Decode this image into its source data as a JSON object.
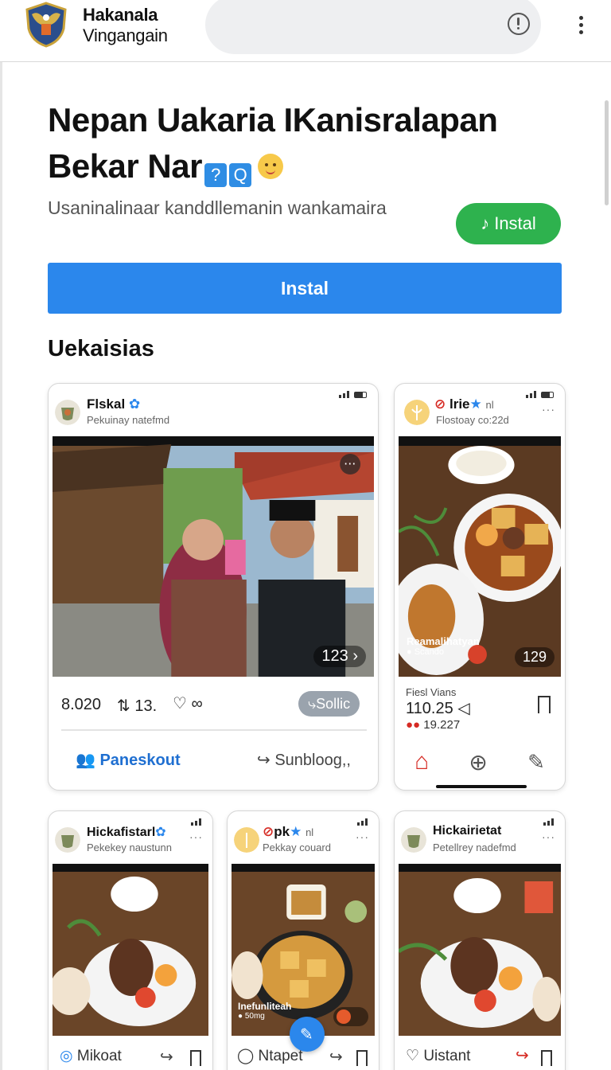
{
  "header": {
    "app_name_line1": "Hakanala",
    "app_name_line2": "Vingangain",
    "search_placeholder": ""
  },
  "hero": {
    "headline_line1": "Nepan Uakaria IKanisralapan",
    "headline_line2": "Bekar Nar",
    "headline_icons": [
      "?",
      "Q"
    ],
    "subtitle": "Usaninalinaar kanddllemanin wankamaira",
    "install_pill_label": "Instal",
    "install_bar_label": "Instal"
  },
  "section": {
    "title": "Uekaisias"
  },
  "cards": {
    "card1": {
      "name": "Flskal",
      "subtitle": "Pekuinay natefmd",
      "photo_badge": "123",
      "likes": "8.020",
      "reposts": "13.",
      "share_label": "Sollic",
      "action_primary": "Paneskout",
      "action_secondary": "Sunbloog,,"
    },
    "card2": {
      "name": "lrie",
      "name_suffix": "nl",
      "subtitle": "Flostoay co:22d",
      "photo_caption": "Reamalihatyan",
      "photo_subcaption": "Scando",
      "photo_badge": "129",
      "meta_label": "Fiesl Vians",
      "value": "110.25",
      "reactions": "19.227"
    },
    "card3": {
      "name": "Hickafistarl",
      "subtitle": "Pekekey naustunn",
      "action": "Mikoat"
    },
    "card4": {
      "name": "pk",
      "name_suffix": "nl",
      "subtitle": "Pekkay couard",
      "photo_caption": "Inefunliteah",
      "photo_subcaption": "50mg",
      "action": "Ntapet"
    },
    "card5": {
      "name": "Hickairietat",
      "subtitle": "Petellrey nadefmd",
      "action": "Uistant"
    }
  },
  "colors": {
    "install_green": "#2eb24e",
    "install_blue": "#2b87ec",
    "link_blue": "#1f6fd1",
    "home_red": "#d62b24"
  },
  "icons": [
    "logo-emblem",
    "info-icon",
    "kebab-menu-icon",
    "music-note-icon",
    "more-icon",
    "comment-icon",
    "heart-icon",
    "bookmark-icon",
    "share-icon",
    "home-icon",
    "add-icon",
    "edit-icon"
  ]
}
